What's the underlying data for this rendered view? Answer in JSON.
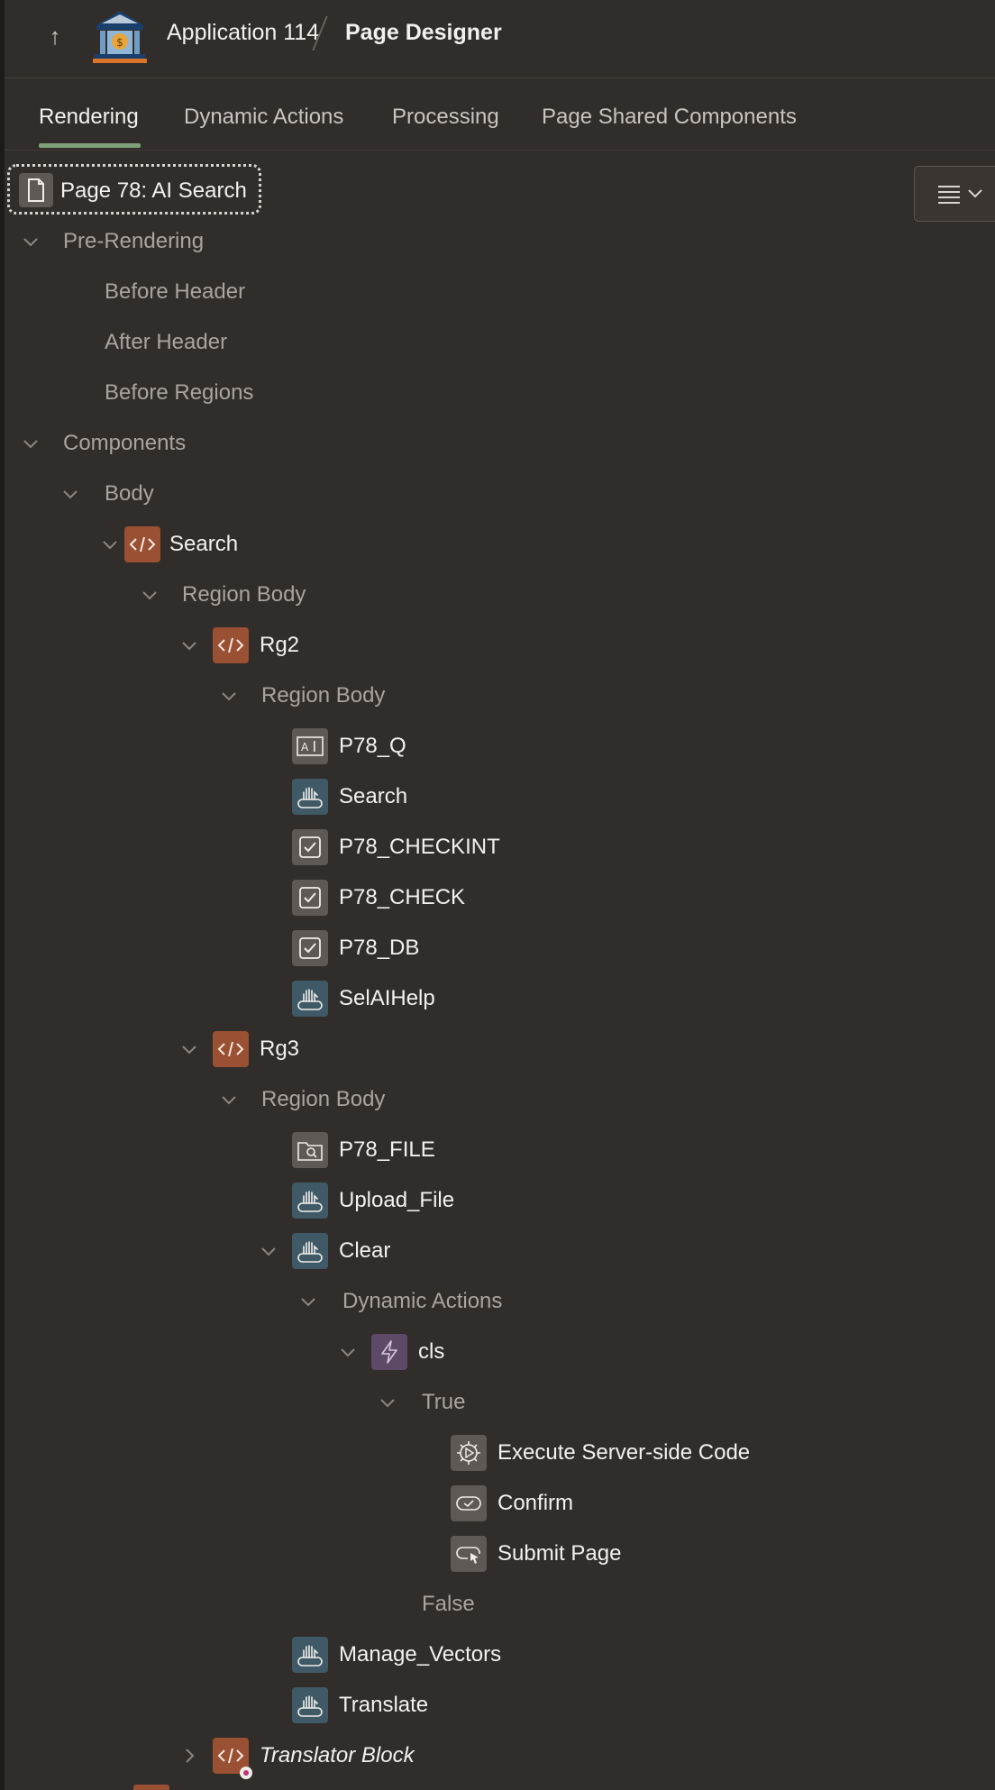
{
  "header": {
    "app_title": "Application 114",
    "page_title": "Page Designer"
  },
  "tabs": [
    "Rendering",
    "Dynamic Actions",
    "Processing",
    "Page Shared Components"
  ],
  "active_tab": "Rendering",
  "page_node": {
    "label": "Page 78: AI Search"
  },
  "tree": {
    "pre_rendering": "Pre-Rendering",
    "before_header": "Before Header",
    "after_header": "After Header",
    "before_regions": "Before Regions",
    "components": "Components",
    "body": "Body",
    "search_region": "Search",
    "search_region_body": "Region Body",
    "rg2": "Rg2",
    "rg2_region_body": "Region Body",
    "p78_q": "P78_Q",
    "search_button": "Search",
    "p78_checkint": "P78_CHECKINT",
    "p78_check": "P78_CHECK",
    "p78_db": "P78_DB",
    "selaihelp": "SelAIHelp",
    "rg3": "Rg3",
    "rg3_region_body": "Region Body",
    "p78_file": "P78_FILE",
    "upload_file": "Upload_File",
    "clear": "Clear",
    "dynamic_actions": "Dynamic Actions",
    "cls": "cls",
    "true_branch": "True",
    "execute_server_side_code": "Execute Server-side Code",
    "confirm": "Confirm",
    "submit_page": "Submit Page",
    "false_branch": "False",
    "manage_vectors": "Manage_Vectors",
    "translate": "Translate",
    "translator_block": "Translator Block"
  }
}
